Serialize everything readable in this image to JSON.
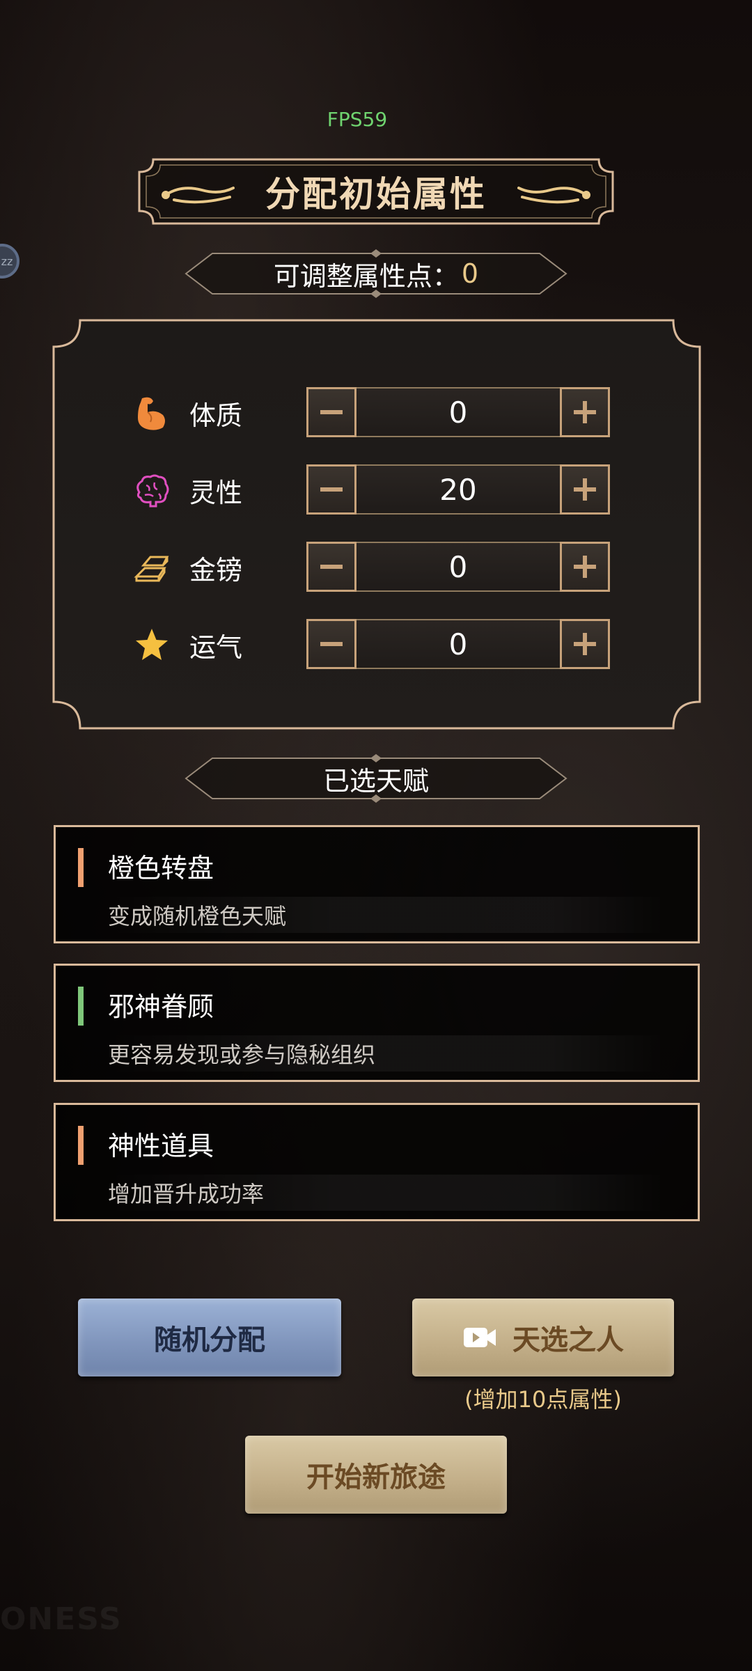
{
  "hud": {
    "fps": "FPS59",
    "side_icon": "zz"
  },
  "header": {
    "title": "分配初始属性"
  },
  "points": {
    "label": "可调整属性点：",
    "value": "0"
  },
  "attributes": [
    {
      "icon": "muscle-icon",
      "label": "体质",
      "value": "0"
    },
    {
      "icon": "brain-icon",
      "label": "灵性",
      "value": "20"
    },
    {
      "icon": "gold-bars-icon",
      "label": "金镑",
      "value": "0"
    },
    {
      "icon": "star-icon",
      "label": "运气",
      "value": "0"
    }
  ],
  "talents": {
    "title": "已选天赋",
    "items": [
      {
        "name": "橙色转盘",
        "desc": "变成随机橙色天赋",
        "color": "#f0a070"
      },
      {
        "name": "邪神眷顾",
        "desc": "更容易发现或参与隐秘组织",
        "color": "#7fc77a"
      },
      {
        "name": "神性道具",
        "desc": "增加晋升成功率",
        "color": "#f0a070"
      }
    ]
  },
  "actions": {
    "random": "随机分配",
    "chosen": "天选之人",
    "chosen_hint": "(增加10点属性)",
    "start": "开始新旅途"
  },
  "watermark": "ONESS",
  "colors": {
    "gold": "#e9c98a",
    "frame": "#d9b99a",
    "fps": "#6fd36f"
  }
}
